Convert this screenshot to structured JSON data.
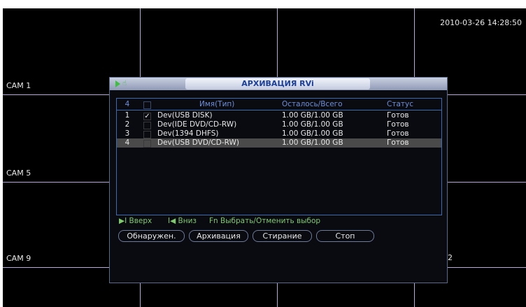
{
  "overlay": {
    "timestamp": "2010-03-26 14:28:50",
    "cams": [
      "CAM 1",
      "CAM 5",
      "CAM 9"
    ],
    "edge_digit": "2"
  },
  "dialog": {
    "title": "АРХИВАЦИЯ RVi",
    "icons": [
      "play-icon",
      "hand-icon"
    ],
    "header": {
      "count": "4",
      "name": "Имя(Тип)",
      "space": "Осталось/Всего",
      "status": "Статус"
    },
    "rows": [
      {
        "num": "1",
        "checked": true,
        "name": "Dev(USB DISK)",
        "space": "1.00 GB/1.00 GB",
        "status": "Готов"
      },
      {
        "num": "2",
        "checked": false,
        "name": "Dev(IDE DVD/CD-RW)",
        "space": "1.00 GB/1.00 GB",
        "status": "Готов"
      },
      {
        "num": "3",
        "checked": false,
        "name": "Dev(1394 DHFS)",
        "space": "1.00 GB/1.00 GB",
        "status": "Готов"
      },
      {
        "num": "4",
        "checked": false,
        "name": "Dev(USB DVD/CD-RW)",
        "space": "1.00 GB/1.00 GB",
        "status": "Готов",
        "selected": true
      }
    ],
    "hints": {
      "up": "▶I Вверх",
      "down": "I◀ Вниз",
      "fn": "Fn Выбрать/Отменить выбор"
    },
    "buttons": {
      "detect": "Обнаружен.",
      "archive": "Архивация",
      "erase": "Стирание",
      "stop": "Стоп"
    }
  },
  "colors": {
    "grid": "#b8a8e0",
    "title_text": "#1a3f9c",
    "hint_green": "#7fc96f",
    "header_blue": "#6f8fd8"
  }
}
